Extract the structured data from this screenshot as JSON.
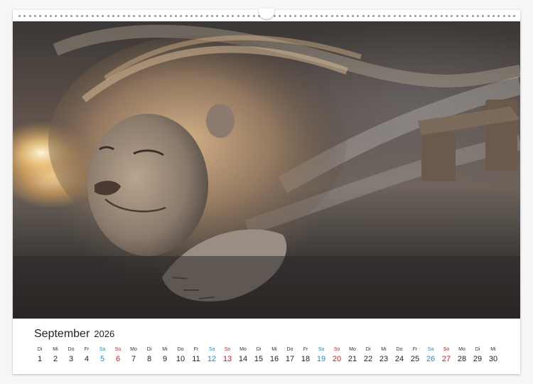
{
  "calendar": {
    "month": "September",
    "year": "2026",
    "days": [
      {
        "wd": "Di",
        "n": "1",
        "t": "w"
      },
      {
        "wd": "Mi",
        "n": "2",
        "t": "w"
      },
      {
        "wd": "Do",
        "n": "3",
        "t": "w"
      },
      {
        "wd": "Fr",
        "n": "4",
        "t": "w"
      },
      {
        "wd": "Sa",
        "n": "5",
        "t": "sat"
      },
      {
        "wd": "So",
        "n": "6",
        "t": "sun"
      },
      {
        "wd": "Mo",
        "n": "7",
        "t": "w"
      },
      {
        "wd": "Di",
        "n": "8",
        "t": "w"
      },
      {
        "wd": "Mi",
        "n": "9",
        "t": "w"
      },
      {
        "wd": "Do",
        "n": "10",
        "t": "w"
      },
      {
        "wd": "Fr",
        "n": "11",
        "t": "w"
      },
      {
        "wd": "Sa",
        "n": "12",
        "t": "sat"
      },
      {
        "wd": "So",
        "n": "13",
        "t": "sun"
      },
      {
        "wd": "Mo",
        "n": "14",
        "t": "w"
      },
      {
        "wd": "Di",
        "n": "15",
        "t": "w"
      },
      {
        "wd": "Mi",
        "n": "16",
        "t": "w"
      },
      {
        "wd": "Do",
        "n": "17",
        "t": "w"
      },
      {
        "wd": "Fr",
        "n": "18",
        "t": "w"
      },
      {
        "wd": "Sa",
        "n": "19",
        "t": "sat"
      },
      {
        "wd": "So",
        "n": "20",
        "t": "sun"
      },
      {
        "wd": "Mo",
        "n": "21",
        "t": "w"
      },
      {
        "wd": "Di",
        "n": "22",
        "t": "w"
      },
      {
        "wd": "Mi",
        "n": "23",
        "t": "w"
      },
      {
        "wd": "Do",
        "n": "24",
        "t": "w"
      },
      {
        "wd": "Fr",
        "n": "25",
        "t": "w"
      },
      {
        "wd": "Sa",
        "n": "26",
        "t": "sat"
      },
      {
        "wd": "So",
        "n": "27",
        "t": "sun"
      },
      {
        "wd": "Mo",
        "n": "28",
        "t": "w"
      },
      {
        "wd": "Di",
        "n": "29",
        "t": "w"
      },
      {
        "wd": "Mi",
        "n": "30",
        "t": "w"
      }
    ]
  },
  "colors": {
    "saturday": "#1b8fc4",
    "sunday": "#c0202a",
    "text": "#222222"
  }
}
